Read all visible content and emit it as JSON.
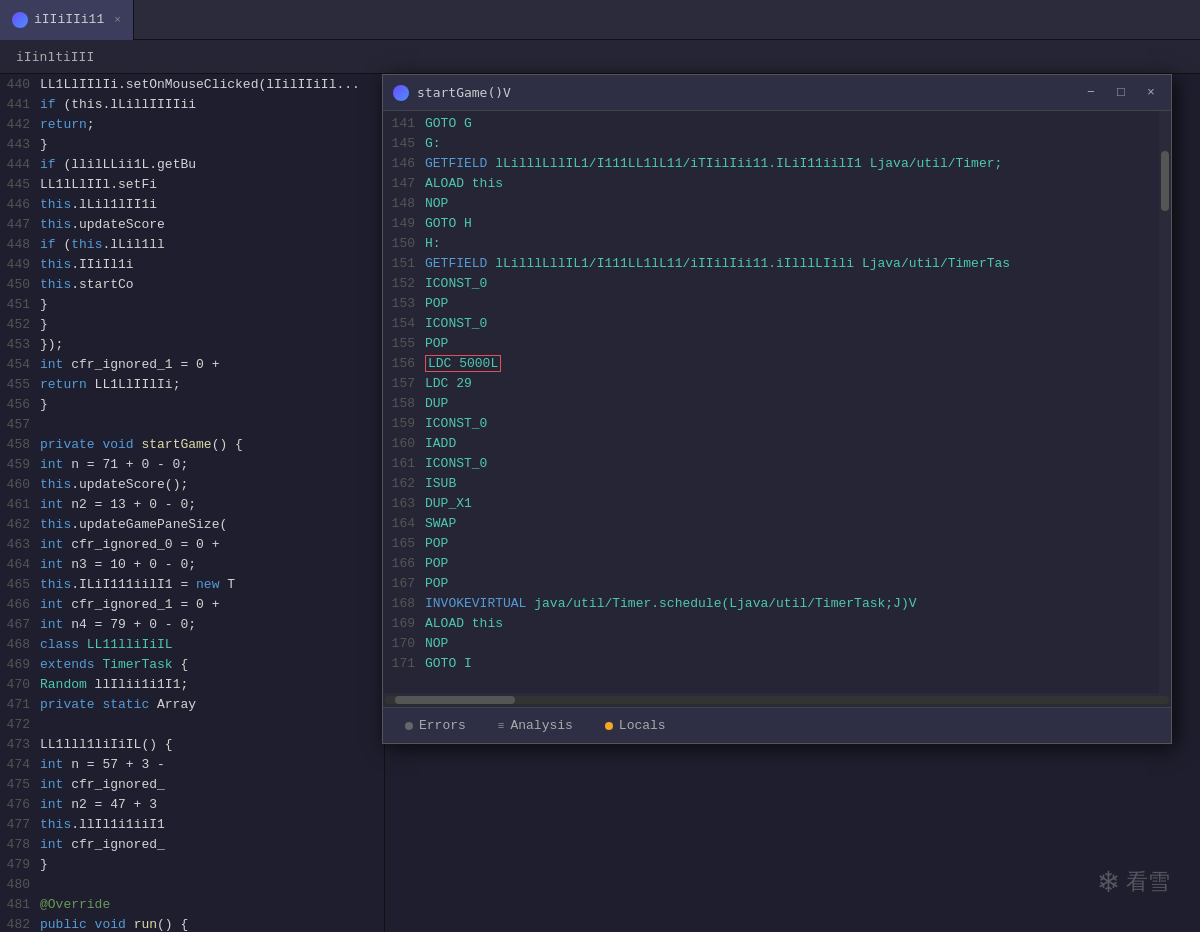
{
  "app": {
    "title": "iIIiIIi11",
    "window_title": "iIin1tiIII"
  },
  "tab": {
    "label": "iIIiIIi11",
    "close": "×"
  },
  "popup": {
    "title": "startGame()V",
    "minimize": "−",
    "maximize": "□",
    "close": "×",
    "bottom_tabs": [
      {
        "label": "Errors",
        "dot_class": "dot-gray"
      },
      {
        "label": "Analysis",
        "dot_class": "dot-gray"
      },
      {
        "label": "Locals",
        "dot_class": "dot-orange"
      }
    ]
  },
  "left_code": [
    {
      "num": "440",
      "text": "        LL1LlIIlIi.setOnMouseClicked(lIilIIiIl..."
    },
    {
      "num": "441",
      "text": "            if (this.lLillIIIIii"
    },
    {
      "num": "442",
      "text": "                return;"
    },
    {
      "num": "443",
      "text": "            }"
    },
    {
      "num": "444",
      "text": "            if (llilLLii1L.getBu"
    },
    {
      "num": "445",
      "text": "                LL1lLlIIl.setFi"
    },
    {
      "num": "446",
      "text": "                this.lLil1lII1i"
    },
    {
      "num": "447",
      "text": "                this.updateScore"
    },
    {
      "num": "448",
      "text": "                if (this.lLil1ll"
    },
    {
      "num": "449",
      "text": "                    this.IIiIl1i"
    },
    {
      "num": "450",
      "text": "                    this.startCo"
    },
    {
      "num": "451",
      "text": "                }"
    },
    {
      "num": "452",
      "text": "            }"
    },
    {
      "num": "453",
      "text": "        });"
    },
    {
      "num": "454",
      "text": "        int cfr_ignored_1 = 0 +"
    },
    {
      "num": "455",
      "text": "        return LL1LlIIlIi;"
    },
    {
      "num": "456",
      "text": "    }"
    },
    {
      "num": "457",
      "text": ""
    },
    {
      "num": "458",
      "text": "    private void startGame() {"
    },
    {
      "num": "459",
      "text": "        int n = 71 + 0 - 0;"
    },
    {
      "num": "460",
      "text": "        this.updateScore();"
    },
    {
      "num": "461",
      "text": "        int n2 = 13 + 0 - 0;"
    },
    {
      "num": "462",
      "text": "        this.updateGamePaneSize("
    },
    {
      "num": "463",
      "text": "        int cfr_ignored_0 = 0 +"
    },
    {
      "num": "464",
      "text": "        int n3 = 10 + 0 - 0;"
    },
    {
      "num": "465",
      "text": "        this.ILiI111iilI1 = new T"
    },
    {
      "num": "466",
      "text": "        int cfr_ignored_1 = 0 +"
    },
    {
      "num": "467",
      "text": "        int n4 = 79 + 0 - 0;"
    },
    {
      "num": "468",
      "text": "        class LL11lliIiIL"
    },
    {
      "num": "469",
      "text": "        extends TimerTask {"
    },
    {
      "num": "470",
      "text": "            Random llIlii1i1I1;"
    },
    {
      "num": "471",
      "text": "            private static Array"
    },
    {
      "num": "472",
      "text": ""
    },
    {
      "num": "473",
      "text": "            LL1lll1liIiIL() {"
    },
    {
      "num": "474",
      "text": "                int n = 57 + 3 -"
    },
    {
      "num": "475",
      "text": "                int cfr_ignored_"
    },
    {
      "num": "476",
      "text": "                int n2 = 47 + 3"
    },
    {
      "num": "477",
      "text": "                this.llIl1i1iiI1"
    },
    {
      "num": "478",
      "text": "                int cfr_ignored_"
    },
    {
      "num": "479",
      "text": "            }"
    },
    {
      "num": "480",
      "text": ""
    },
    {
      "num": "481",
      "text": "            @Override"
    },
    {
      "num": "482",
      "text": "            public void run() {"
    }
  ],
  "popup_code": [
    {
      "num": "141",
      "text": "GOTO G"
    },
    {
      "num": "145",
      "text": "G:"
    },
    {
      "num": "146",
      "text": "GETFIELD lLilllLllIL1/I111LL1lL11/iTIilIii11.ILiI11iilI1 Ljava/util/Timer;"
    },
    {
      "num": "147",
      "text": "ALOAD this"
    },
    {
      "num": "148",
      "text": "NOP"
    },
    {
      "num": "149",
      "text": "GOTO H"
    },
    {
      "num": "150",
      "text": "H:"
    },
    {
      "num": "151",
      "text": "GETFIELD lLilllLllIL1/I111LL1lL11/iIIilIii11.iIlllLIili Ljava/util/TimerTas"
    },
    {
      "num": "152",
      "text": "ICONST_0"
    },
    {
      "num": "153",
      "text": "POP"
    },
    {
      "num": "154",
      "text": "ICONST_0"
    },
    {
      "num": "155",
      "text": "POP"
    },
    {
      "num": "156",
      "text": "LDC 5000L",
      "highlighted": true
    },
    {
      "num": "157",
      "text": "LDC 29"
    },
    {
      "num": "158",
      "text": "DUP"
    },
    {
      "num": "159",
      "text": "ICONST_0"
    },
    {
      "num": "160",
      "text": "IADD"
    },
    {
      "num": "161",
      "text": "ICONST_0"
    },
    {
      "num": "162",
      "text": "ISUB"
    },
    {
      "num": "163",
      "text": "DUP_X1"
    },
    {
      "num": "164",
      "text": "SWAP"
    },
    {
      "num": "165",
      "text": "POP"
    },
    {
      "num": "166",
      "text": "POP"
    },
    {
      "num": "167",
      "text": "POP"
    },
    {
      "num": "168",
      "text": "INVOKEVIRTUAL java/util/Timer.schedule(Ljava/util/TimerTask;J)V"
    },
    {
      "num": "169",
      "text": "ALOAD this"
    },
    {
      "num": "170",
      "text": "NOP"
    },
    {
      "num": "171",
      "text": "GOTO I"
    }
  ],
  "watermark": {
    "text": "看雪"
  }
}
